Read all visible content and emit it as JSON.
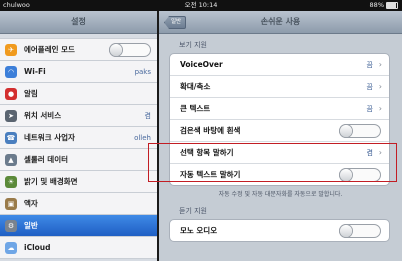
{
  "status": {
    "carrier": "chulwoo",
    "time": "오전 10:14",
    "battery_text": "88%",
    "battery_level": 0.88
  },
  "master": {
    "title": "설정",
    "items": [
      {
        "label": "에어플레인 모드",
        "icon": "airplane-icon",
        "icon_color": "#f09a1e",
        "toggle": "off"
      },
      {
        "label": "Wi-Fi",
        "icon": "wifi-icon",
        "icon_color": "#3d7fd9",
        "value": "paks"
      },
      {
        "label": "알림",
        "icon": "notifications-icon",
        "icon_color": "#d32f2f"
      },
      {
        "label": "위치 서비스",
        "icon": "location-icon",
        "icon_color": "#5a6470",
        "value": "켬"
      },
      {
        "label": "네트워크 사업자",
        "icon": "phone-icon",
        "icon_color": "#4a7fbf",
        "value": "olleh"
      },
      {
        "label": "셀룰러 데이터",
        "icon": "cellular-icon",
        "icon_color": "#6b7b8c"
      },
      {
        "label": "밝기 및 배경화면",
        "icon": "brightness-icon",
        "icon_color": "#5c8a3a"
      },
      {
        "label": "액자",
        "icon": "picture-frame-icon",
        "icon_color": "#9a7b4a"
      },
      {
        "label": "일반",
        "icon": "gear-icon",
        "icon_color": "#7a838e",
        "selected": true
      },
      {
        "label": "iCloud",
        "icon": "cloud-icon",
        "icon_color": "#6fa6e6"
      }
    ]
  },
  "detail": {
    "back_label": "일반",
    "title": "손쉬운 사용",
    "section_vision": "보기 지원",
    "rows_vision": [
      {
        "label": "VoiceOver",
        "value": "끔",
        "chevron": true
      },
      {
        "label": "확대/축소",
        "value": "끔",
        "chevron": true
      },
      {
        "label": "큰 텍스트",
        "value": "끔",
        "chevron": true
      },
      {
        "label": "검은색 바탕에 흰색",
        "toggle": "off"
      },
      {
        "label": "선택 항목 말하기",
        "value": "켬",
        "chevron": true,
        "highlighted": true
      },
      {
        "label": "자동 텍스트 말하기",
        "toggle": "off"
      }
    ],
    "footnote": "자동 수정 및 자동 대문자화를 자동으로 말합니다.",
    "section_hearing": "듣기 지원",
    "rows_hearing": [
      {
        "label": "모노 오디오",
        "toggle": "off"
      }
    ]
  },
  "colors": {
    "highlight": "#c21d24",
    "selected_row": "#2a6ed6"
  }
}
